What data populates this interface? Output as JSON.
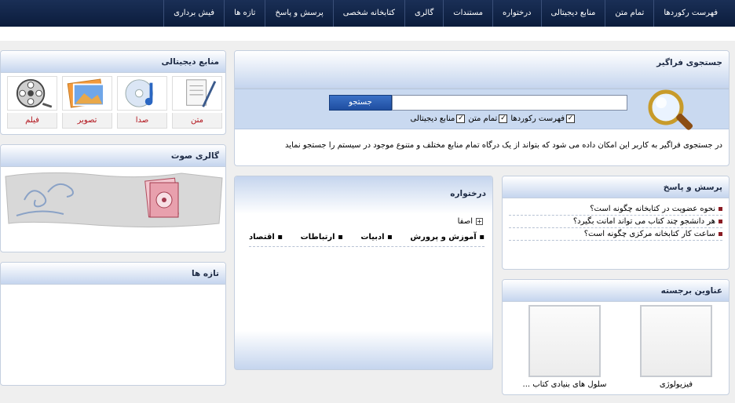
{
  "nav": {
    "items": [
      "فهرست رکوردها",
      "تمام متن",
      "منابع دیجیتالی",
      "درختواره",
      "مستندات",
      "گالری",
      "کتابخانه شخصی",
      "پرسش و پاسخ",
      "تازه ها",
      "فیش برداری"
    ]
  },
  "search": {
    "title": "جستجوی فراگیر",
    "button": "جستجو",
    "input_value": "",
    "checks": [
      {
        "label": "فهرست رکوردها",
        "checked": true
      },
      {
        "label": "تمام متن",
        "checked": true
      },
      {
        "label": "منابع دیجیتالی",
        "checked": true
      }
    ],
    "description": "در جستجوی فراگیر به کاربر این امکان داده می شود که بتواند از یک درگاه تمام منابع مختلف و متنوع موجود در سیستم را جستجو نماید"
  },
  "digital": {
    "title": "منابع دیجیتالی",
    "items": [
      {
        "label": "متن",
        "icon": "text-document-icon"
      },
      {
        "label": "صدا",
        "icon": "audio-cd-icon"
      },
      {
        "label": "تصویر",
        "icon": "photo-icon"
      },
      {
        "label": "فیلم",
        "icon": "film-reel-icon"
      }
    ]
  },
  "audio_gallery": {
    "title": "گالری صوت"
  },
  "news": {
    "title": "تازه ها"
  },
  "qa": {
    "title": "پرسش و پاسخ",
    "items": [
      "نحوه عضویت در کتابخانه چگونه است؟",
      "هر دانشجو چند کتاب می تواند امانت بگیرد؟",
      "ساعت کار کتابخانه مرکزی چگونه است؟"
    ]
  },
  "tree": {
    "title": "درختواره",
    "root": "اصفا",
    "categories": [
      "آموزش و پرورش",
      "ادبیات",
      "ارتباطات",
      "اقتصاد"
    ]
  },
  "featured": {
    "title": "عناوین برجسته",
    "items": [
      "فیزیولوژی",
      "سلول های بنیادی کتاب ..."
    ]
  },
  "colors": {
    "nav_bg": "#0b1c3c",
    "accent_red": "#b2131b",
    "header_blue": "#c5d5ee"
  }
}
